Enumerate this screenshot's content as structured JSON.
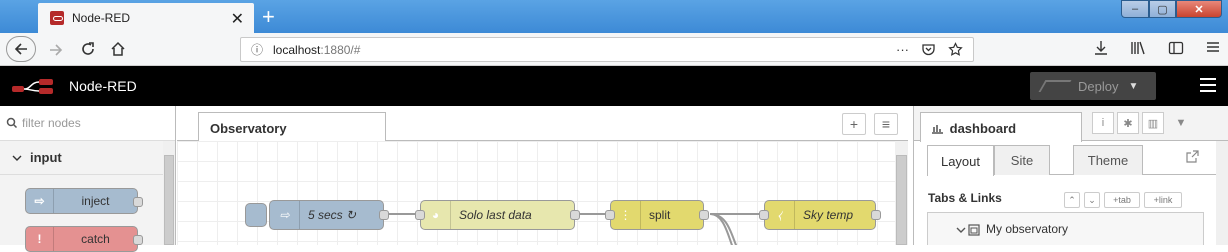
{
  "browser": {
    "tab_title": "Node-RED",
    "tab_close": "✕",
    "new_tab": "+",
    "window_min": "–",
    "window_max": "▢",
    "window_close": "✕",
    "url_host": "localhost",
    "url_rest": ":1880/#",
    "url_info_icon": "ⓘ",
    "url_more": "···",
    "toolbar_icons": [
      "download-icon",
      "library-icon",
      "sidebar-icon",
      "menu-icon"
    ]
  },
  "header": {
    "app_title": "Node-RED",
    "deploy_label": "Deploy",
    "deploy_caret": "▼"
  },
  "palette": {
    "filter_placeholder": "filter nodes",
    "category_label": "input",
    "nodes": [
      {
        "label": "inject",
        "color": "#a6bbcf"
      },
      {
        "label": "catch",
        "color": "#e49191"
      }
    ]
  },
  "workspace": {
    "tab_label": "Observatory",
    "add_button": "+",
    "list_button": "≡",
    "nodes": [
      {
        "label": "5 secs ↻",
        "color": "#a6bbcf"
      },
      {
        "label": "Solo last data",
        "color": "#e7e7ae"
      },
      {
        "label": "split",
        "color": "#e2d96e"
      },
      {
        "label": "Sky temp",
        "color": "#e2d96e"
      }
    ]
  },
  "sidebar": {
    "tab_label": "dashboard",
    "icons": [
      "info-icon",
      "debug-icon",
      "dashboard-icon",
      "dropdown-icon"
    ],
    "dashboard_tabs": [
      "Layout",
      "Site",
      "Theme"
    ],
    "tabs_links_heading": "Tabs & Links",
    "btn_tab": "+tab",
    "btn_link": "+link",
    "item_label": "My observatory"
  }
}
